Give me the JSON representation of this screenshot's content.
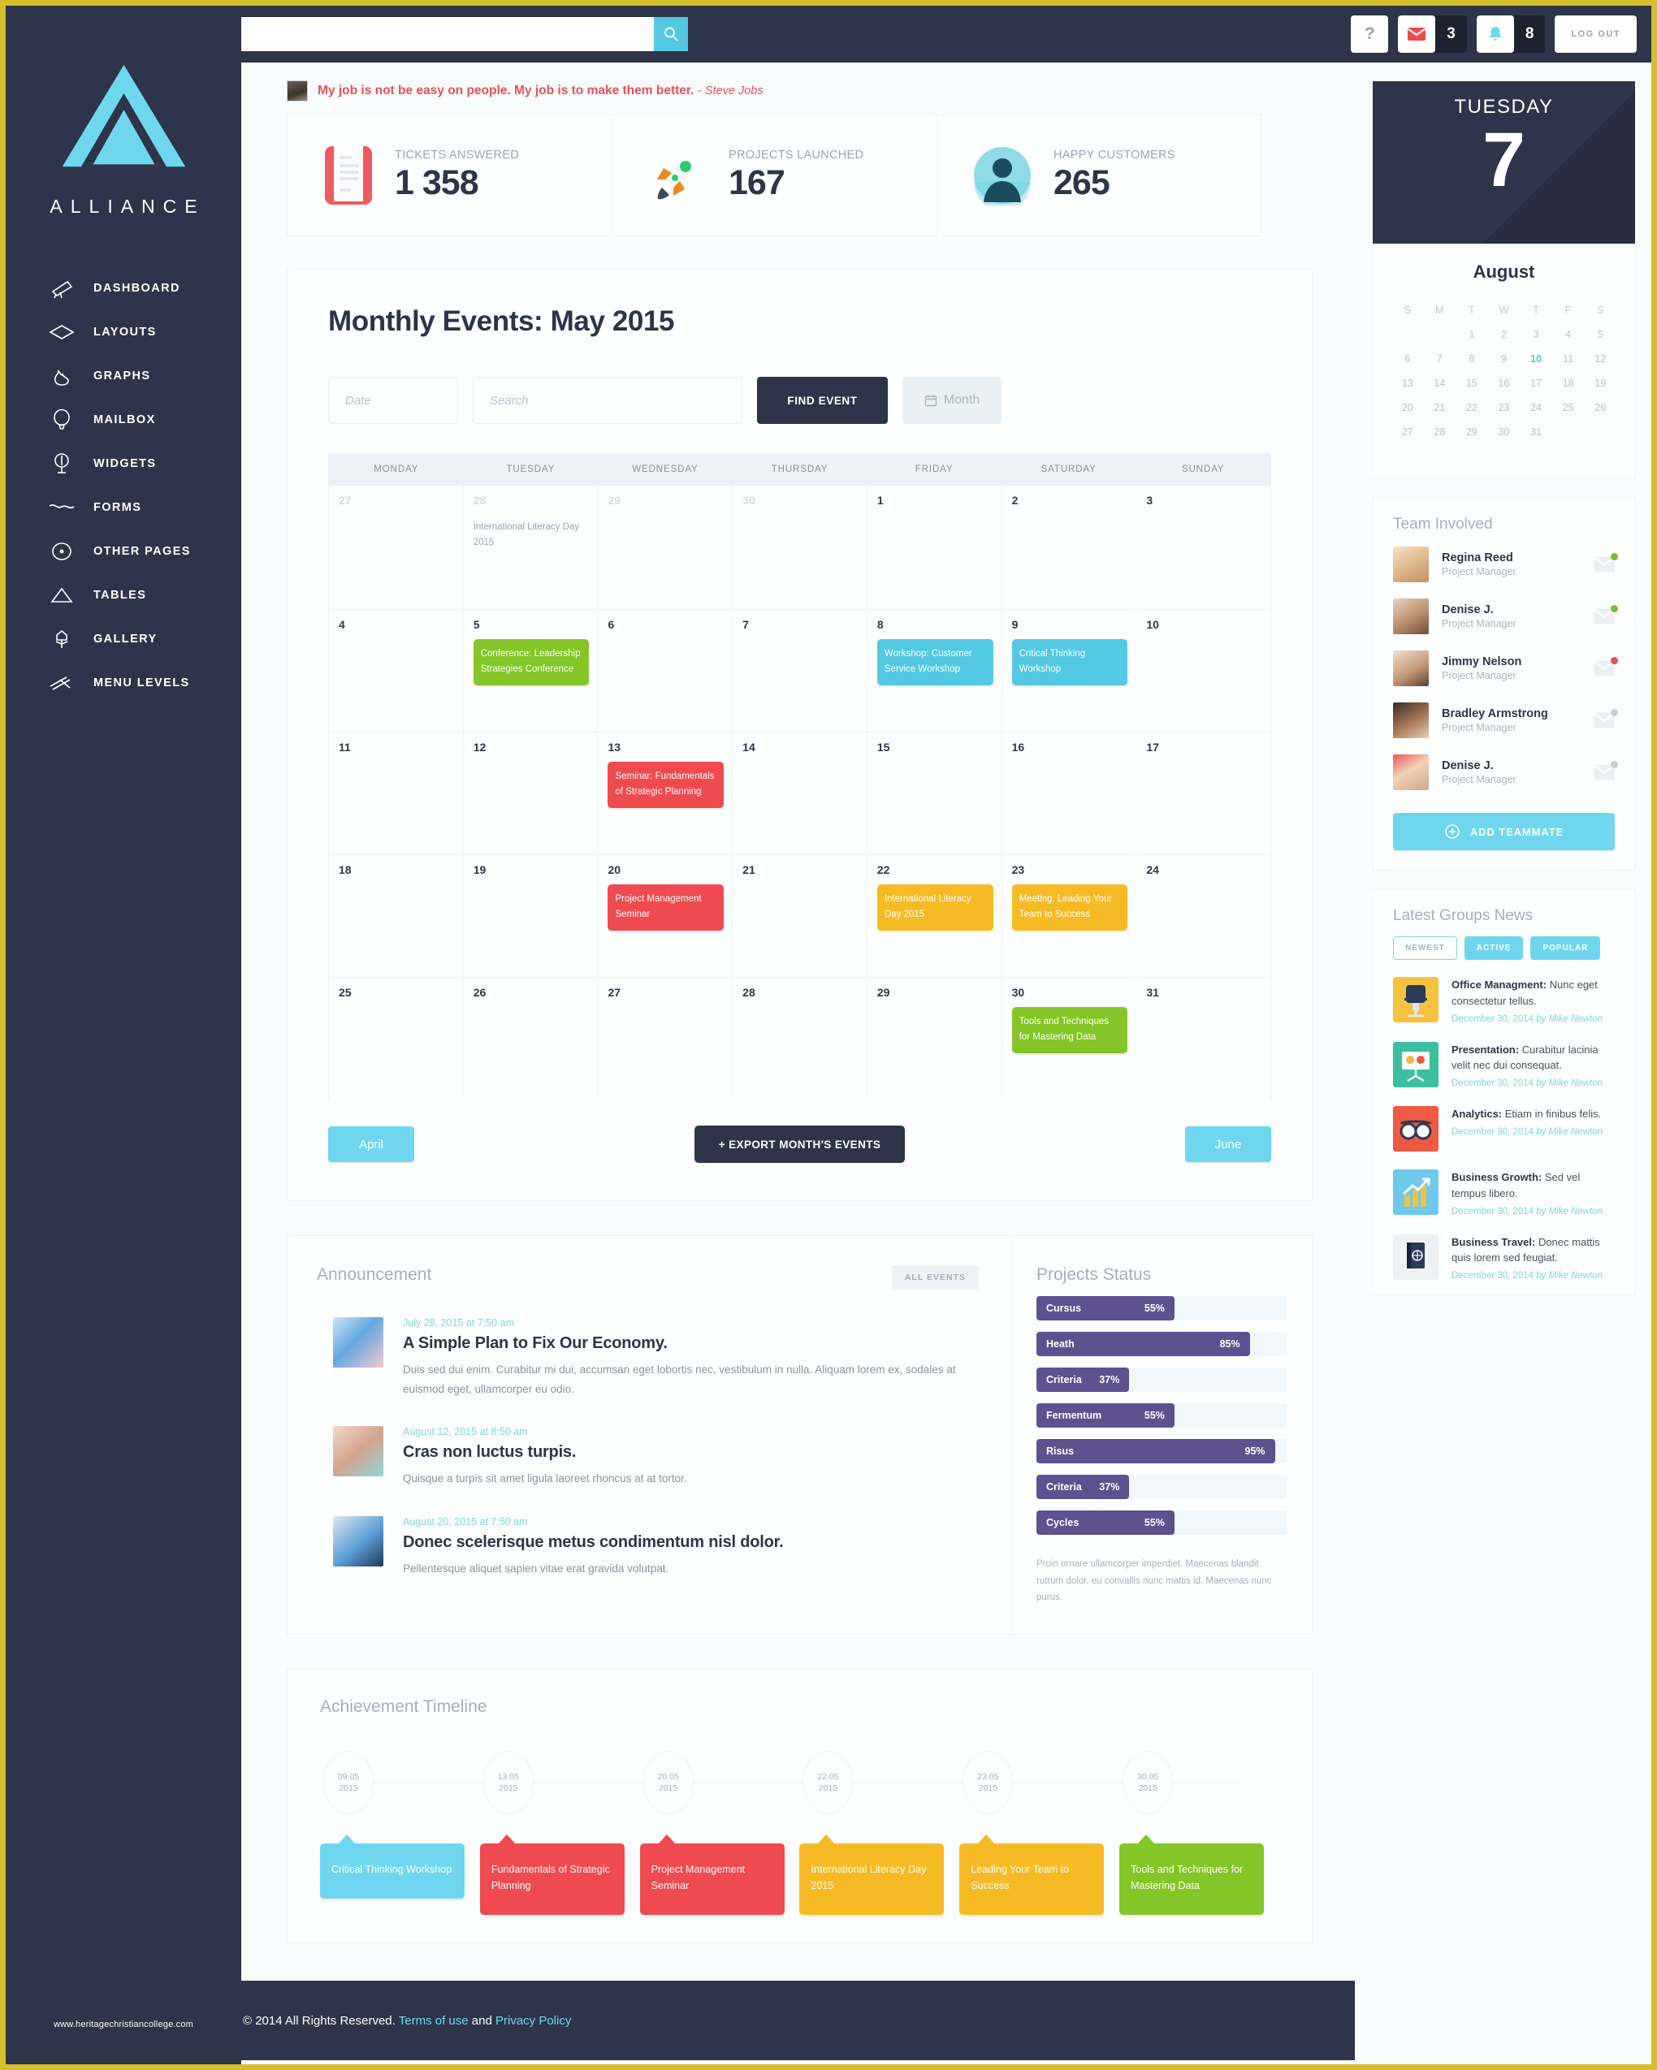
{
  "brand": {
    "name": "ALLIANCE"
  },
  "sidebar": {
    "items": [
      {
        "label": "DASHBOARD",
        "icon": "telescope-icon"
      },
      {
        "label": "LAYOUTS",
        "icon": "layers-icon"
      },
      {
        "label": "GRAPHS",
        "icon": "flame-icon"
      },
      {
        "label": "MAILBOX",
        "icon": "balloon-icon"
      },
      {
        "label": "WIDGETS",
        "icon": "microphone-icon"
      },
      {
        "label": "FORMS",
        "icon": "wave-icon"
      },
      {
        "label": "OTHER PAGES",
        "icon": "eye-icon"
      },
      {
        "label": "TABLES",
        "icon": "triangle-icon"
      },
      {
        "label": "GALLERY",
        "icon": "flower-icon"
      },
      {
        "label": "MENU LEVELS",
        "icon": "lines-icon"
      }
    ],
    "footer_url": "www.heritagechristiancollege.com"
  },
  "topbar": {
    "search_placeholder": "",
    "search_value": "",
    "help_label": "?",
    "mail_count": "3",
    "bell_count": "8",
    "logout_label": "LOG OUT"
  },
  "quote": {
    "text": "My job is not be easy on people. My job is to make them better.",
    "dash": "-",
    "author": "Steve Jobs"
  },
  "stats": [
    {
      "label": "TICKETS ANSWERED",
      "value": "1 358",
      "icon": "notepad-icon"
    },
    {
      "label": "PROJECTS LAUNCHED",
      "value": "167",
      "icon": "rocket-icon"
    },
    {
      "label": "HAPPY CUSTOMERS",
      "value": "265",
      "icon": "user-avatar-icon"
    }
  ],
  "events_panel": {
    "title": "Monthly Events: May 2015",
    "date_placeholder": "Date",
    "search_placeholder": "Search",
    "find_label": "FIND EVENT",
    "month_label": "Month",
    "prev_label": "April",
    "next_label": "June",
    "export_label": "+ EXPORT MONTH'S EVENTS",
    "weekdays": [
      "MONDAY",
      "TUESDAY",
      "WEDNESDAY",
      "THURSDAY",
      "FRIDAY",
      "SATURDAY",
      "SUNDAY"
    ],
    "weeks": [
      [
        {
          "day": "27",
          "muted": true,
          "events": []
        },
        {
          "day": "28",
          "muted": true,
          "events": [
            {
              "text": "International Literacy Day 2015",
              "color": "plain"
            }
          ]
        },
        {
          "day": "29",
          "muted": true,
          "events": []
        },
        {
          "day": "30",
          "muted": true,
          "events": []
        },
        {
          "day": "1",
          "muted": false,
          "events": []
        },
        {
          "day": "2",
          "muted": false,
          "events": []
        },
        {
          "day": "3",
          "muted": false,
          "events": []
        }
      ],
      [
        {
          "day": "4",
          "muted": false,
          "events": []
        },
        {
          "day": "5",
          "muted": false,
          "events": [
            {
              "text": "Conference: Leadership Strategies Conference",
              "color": "green"
            }
          ]
        },
        {
          "day": "6",
          "muted": false,
          "events": []
        },
        {
          "day": "7",
          "muted": false,
          "events": []
        },
        {
          "day": "8",
          "muted": false,
          "events": [
            {
              "text": "Workshop: Customer Service Workshop",
              "color": "blue"
            }
          ]
        },
        {
          "day": "9",
          "muted": false,
          "events": [
            {
              "text": "Critical Thinking Workshop",
              "color": "blue"
            }
          ]
        },
        {
          "day": "10",
          "muted": false,
          "events": []
        }
      ],
      [
        {
          "day": "11",
          "muted": false,
          "events": []
        },
        {
          "day": "12",
          "muted": false,
          "events": []
        },
        {
          "day": "13",
          "muted": false,
          "events": [
            {
              "text": "Seminar: Fundamentals of Strategic Planning",
              "color": "red"
            }
          ]
        },
        {
          "day": "14",
          "muted": false,
          "events": []
        },
        {
          "day": "15",
          "muted": false,
          "events": []
        },
        {
          "day": "16",
          "muted": false,
          "events": []
        },
        {
          "day": "17",
          "muted": false,
          "events": []
        }
      ],
      [
        {
          "day": "18",
          "muted": false,
          "events": []
        },
        {
          "day": "19",
          "muted": false,
          "events": []
        },
        {
          "day": "20",
          "muted": false,
          "events": [
            {
              "text": "Project Management Seminar",
              "color": "red"
            }
          ]
        },
        {
          "day": "21",
          "muted": false,
          "events": []
        },
        {
          "day": "22",
          "muted": false,
          "events": [
            {
              "text": "International Literacy Day 2015",
              "color": "yellow"
            }
          ]
        },
        {
          "day": "23",
          "muted": false,
          "events": [
            {
              "text": "Meeting: Leading Your Team to Success",
              "color": "yellow"
            }
          ]
        },
        {
          "day": "24",
          "muted": false,
          "events": []
        }
      ],
      [
        {
          "day": "25",
          "muted": false,
          "events": []
        },
        {
          "day": "26",
          "muted": false,
          "events": []
        },
        {
          "day": "27",
          "muted": false,
          "events": []
        },
        {
          "day": "28",
          "muted": false,
          "events": []
        },
        {
          "day": "29",
          "muted": false,
          "events": []
        },
        {
          "day": "30",
          "muted": false,
          "events": [
            {
              "text": "Tools and Techniques for Mastering Data",
              "color": "green"
            }
          ]
        },
        {
          "day": "31",
          "muted": false,
          "events": []
        }
      ]
    ]
  },
  "announcement": {
    "title": "Announcement",
    "all_events_label": "ALL EVENTS",
    "items": [
      {
        "date": "July  28, 2015 at 7:50 am",
        "title": "A Simple Plan to Fix Our Economy.",
        "desc": "Duis sed dui enim. Curabitur mi dui, accumsan eget lobortis nec, vestibulum in nulla. Aliquam lorem ex, sodales at euismod eget, ullamcorper eu odio."
      },
      {
        "date": "August  12, 2015 at 8:50 am",
        "title": "Cras non luctus turpis.",
        "desc": "Quisque a turpis sit amet ligula laoreet rhoncus at at tortor."
      },
      {
        "date": "August  20, 2015 at 7:50 am",
        "title": "Donec scelerisque metus condimentum nisl dolor.",
        "desc": "Pellentesque aliquet sapien vitae erat gravida volutpat."
      }
    ]
  },
  "projects_status": {
    "title": "Projects Status",
    "note": "Proin ornare ullamcorper imperdiet. Maecenas blandit rutrum dolor, eu convallis nunc mattis id. Maecenas nunc purus.",
    "bar_color": "#5d518f",
    "bars": [
      {
        "label": "Cursus",
        "value": "55%",
        "pct": 55
      },
      {
        "label": "Heath",
        "value": "85%",
        "pct": 85
      },
      {
        "label": "Criteria",
        "value": "37%",
        "pct": 37
      },
      {
        "label": "Fermentum",
        "value": "55%",
        "pct": 55
      },
      {
        "label": "Risus",
        "value": "95%",
        "pct": 95
      },
      {
        "label": "Criteria",
        "value": "37%",
        "pct": 37
      },
      {
        "label": "Cycles",
        "value": "55%",
        "pct": 55
      }
    ]
  },
  "timeline": {
    "title": "Achievement Timeline",
    "items": [
      {
        "date1": "09.05",
        "date2": "2015",
        "text": "Critical Thinking Workshop",
        "color": "blue"
      },
      {
        "date1": "13.05",
        "date2": "2015",
        "text": "Fundamentals of Strategic Planning",
        "color": "red"
      },
      {
        "date1": "20.05",
        "date2": "2015",
        "text": "Project Management Seminar",
        "color": "red"
      },
      {
        "date1": "22.05",
        "date2": "2015",
        "text": "International Literacy Day 2015",
        "color": "yellow"
      },
      {
        "date1": "23.05",
        "date2": "2015",
        "text": "Leading Your Team to Success",
        "color": "yellow"
      },
      {
        "date1": "30.05",
        "date2": "2015",
        "text": "Tools and Techniques for Mastering Data",
        "color": "green"
      }
    ]
  },
  "today_widget": {
    "day_of_week": "TUESDAY",
    "day_number": "7"
  },
  "mini_calendar": {
    "month": "August",
    "dow": [
      "S",
      "M",
      "T",
      "W",
      "T",
      "F",
      "S"
    ],
    "cells": [
      "",
      "",
      "1",
      "2",
      "3",
      "4",
      "5",
      "6",
      "7",
      "8",
      "9",
      "10",
      "11",
      "12",
      "13",
      "14",
      "15",
      "16",
      "17",
      "18",
      "19",
      "20",
      "21",
      "22",
      "23",
      "24",
      "25",
      "26",
      "27",
      "28",
      "29",
      "30",
      "31",
      "",
      "",
      ""
    ],
    "highlight": "10"
  },
  "team": {
    "title": "Team Involved",
    "add_label": "ADD TEAMMATE",
    "members": [
      {
        "name": "Regina Reed",
        "role": "Project Manager",
        "status": "green"
      },
      {
        "name": "Denise J.",
        "role": "Project Manager",
        "status": "green"
      },
      {
        "name": "Jimmy Nelson",
        "role": "Project Manager",
        "status": "red"
      },
      {
        "name": "Bradley Armstrong",
        "role": "Project Manager",
        "status": "gray"
      },
      {
        "name": "Denise J.",
        "role": "Project Manager",
        "status": "gray"
      }
    ]
  },
  "news": {
    "title": "Latest Groups News",
    "tabs": [
      {
        "label": "NEWEST",
        "style": "out"
      },
      {
        "label": "ACTIVE",
        "style": "fill"
      },
      {
        "label": "POPULAR",
        "style": "fill"
      }
    ],
    "items": [
      {
        "bold": "Office Managment:",
        "text": " Nunc eget consectetur tellus.",
        "date": "December 30, 2014",
        "by": "by Mike Newton",
        "icon": "office-chair-icon",
        "bg": "#f7c23f"
      },
      {
        "bold": "Presentation:",
        "text": " Curabitur lacinia velit nec dui consequat.",
        "date": "December 30, 2014",
        "by": "by Mike Newton",
        "icon": "presentation-screen-icon",
        "bg": "#3bbfa0"
      },
      {
        "bold": "Analytics:",
        "text": " Etiam in finibus felis.",
        "date": "December 30, 2014",
        "by": "by Mike Newton",
        "icon": "glasses-icon",
        "bg": "#ef5a44"
      },
      {
        "bold": "Business Growth:",
        "text": " Sed vel tempus libero.",
        "date": "December 30, 2014",
        "by": "by Mike Newton",
        "icon": "growth-chart-icon",
        "bg": "#6ec9ec"
      },
      {
        "bold": "Business Travel:",
        "text": " Donec mattis quis lorem sed feugiat.",
        "date": "December 30, 2014",
        "by": "by Mike Newton",
        "icon": "passport-icon",
        "bg": "#eef2f5"
      }
    ]
  },
  "footer": {
    "copyright": "© 2014 All Rights Reserved.",
    "terms": "Terms of use",
    "and": "and",
    "privacy": "Privacy Policy"
  }
}
